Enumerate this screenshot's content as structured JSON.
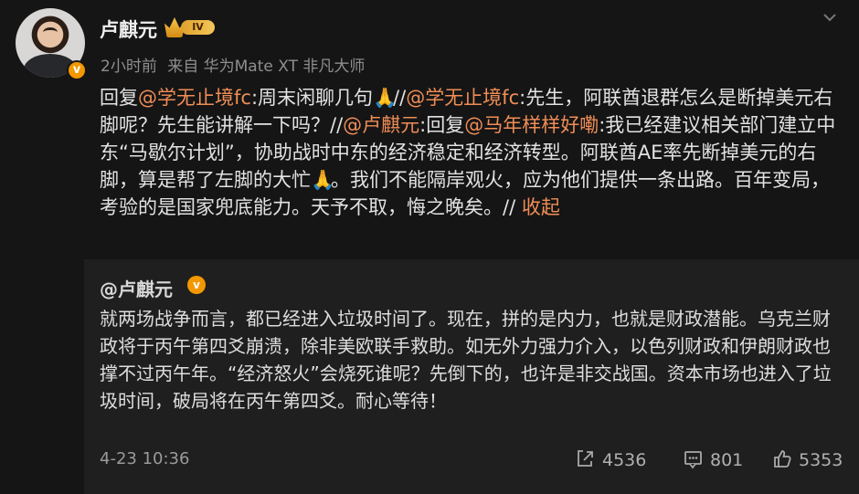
{
  "user": {
    "name": "卢麒元",
    "level": "IV",
    "verified_badge": "v"
  },
  "meta": {
    "time": "2小时前",
    "source": "来自 华为Mate XT 非凡大师"
  },
  "post": {
    "reply_prefix": "回复",
    "mention_1": "@学无止境fc",
    "text_1": ":周末闲聊几句",
    "emoji": "🙏",
    "separator_1": "//",
    "mention_2": "@学无止境fc",
    "text_2": ":先生，阿联酋退群怎么是断掉美元右脚呢？先生能讲解一下吗？",
    "separator_2": "//",
    "mention_3": "@卢麒元",
    "text_3": ":回复",
    "mention_4": "@马年样样好嘞",
    "text_4": ":我已经建议相关部门建立中东“马歇尔计划”，协助战时中东的经济稳定和经济转型。阿联酋AE率先断掉美元的右脚，算是帮了左脚的大忙",
    "text_5": "。我们不能隔岸观火，应为他们提供一条出路。百年变局，考验的是国家兜底能力。天予不取，悔之晚矣。",
    "separator_3": "//",
    "collapse": "收起"
  },
  "quote": {
    "author": "@卢麒元",
    "verified_badge": "v",
    "text": "就两场战争而言，都已经进入垃圾时间了。现在，拼的是内力，也就是财政潜能。乌克兰财政将于丙午第四爻崩溃，除非美欧联手救助。如无外力强力介入，以色列财政和伊朗财政也撑不过丙午年。“经济怒火”会烧死谁呢？先倒下的，也许是非交战国。资本市场也进入了垃圾时间，破局将在丙午第四爻。耐心等待！",
    "date": "4-23 10:36"
  },
  "stats": {
    "reposts": "4536",
    "comments": "801",
    "likes": "5353"
  },
  "icons": {
    "menu": "chevron-down-icon",
    "repost": "repost-icon",
    "comment": "comment-icon",
    "like": "like-icon"
  },
  "colors": {
    "background": "#151515",
    "quote_background": "#1f1f1f",
    "mention": "#f08d56",
    "verified": "#f39800"
  }
}
